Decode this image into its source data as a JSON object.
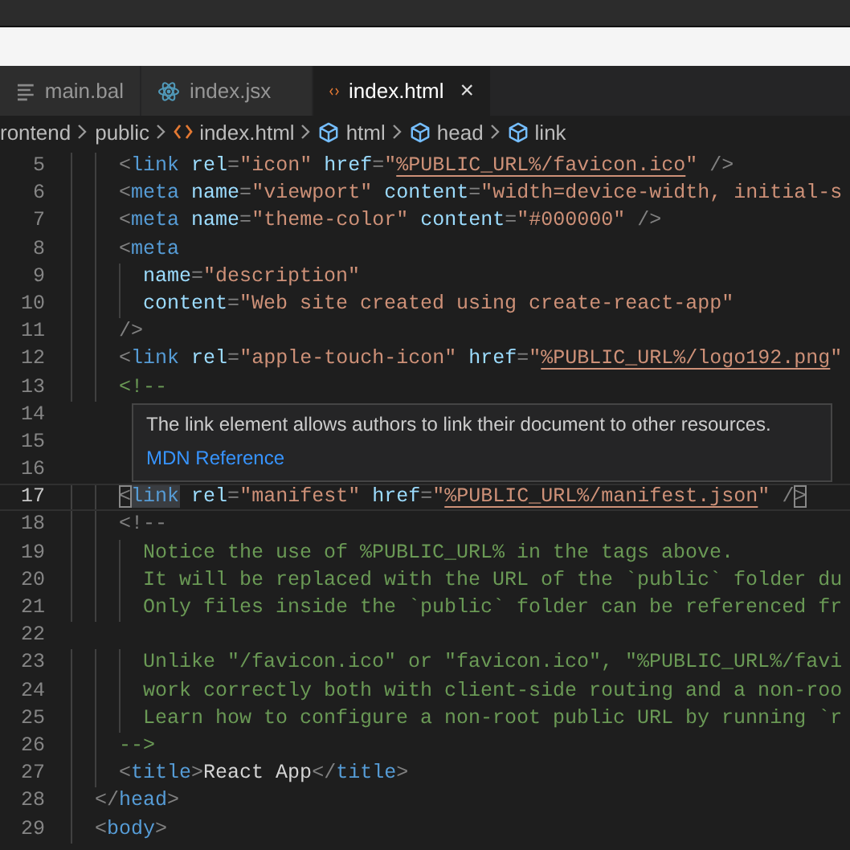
{
  "tabs": [
    {
      "label": "main.bal",
      "kind": "bal",
      "selected": false
    },
    {
      "label": "index.jsx",
      "kind": "react",
      "selected": false
    },
    {
      "label": "index.html",
      "kind": "html",
      "selected": true,
      "close": "×"
    }
  ],
  "breadcrumb": [
    {
      "label": "rontend",
      "kind": "folder"
    },
    {
      "label": "public",
      "kind": "folder"
    },
    {
      "label": "index.html",
      "kind": "file"
    },
    {
      "label": "html",
      "kind": "element"
    },
    {
      "label": "head",
      "kind": "element"
    },
    {
      "label": "link",
      "kind": "element"
    }
  ],
  "lines": [
    {
      "n": "5",
      "current": false,
      "tokens": [
        {
          "kind": "p",
          "text": "    <"
        },
        {
          "kind": "tag",
          "text": "link"
        },
        {
          "kind": "attr",
          "text": " rel"
        },
        {
          "kind": "p",
          "text": "="
        },
        {
          "kind": "str",
          "text": "\"icon\""
        },
        {
          "kind": "attr",
          "text": " href"
        },
        {
          "kind": "p",
          "text": "="
        },
        {
          "kind": "str",
          "text": "\""
        },
        {
          "kind": "url",
          "text": "%PUBLIC_URL%/favicon.ico"
        },
        {
          "kind": "str",
          "text": "\""
        },
        {
          "kind": "p",
          "text": " />"
        }
      ]
    },
    {
      "n": "6",
      "current": false,
      "tokens": [
        {
          "kind": "p",
          "text": "    <"
        },
        {
          "kind": "tag",
          "text": "meta"
        },
        {
          "kind": "attr",
          "text": " name"
        },
        {
          "kind": "p",
          "text": "="
        },
        {
          "kind": "str",
          "text": "\"viewport\""
        },
        {
          "kind": "attr",
          "text": " content"
        },
        {
          "kind": "p",
          "text": "="
        },
        {
          "kind": "str",
          "text": "\"width=device-width, initial-s"
        }
      ]
    },
    {
      "n": "7",
      "current": false,
      "tokens": [
        {
          "kind": "p",
          "text": "    <"
        },
        {
          "kind": "tag",
          "text": "meta"
        },
        {
          "kind": "attr",
          "text": " name"
        },
        {
          "kind": "p",
          "text": "="
        },
        {
          "kind": "str",
          "text": "\"theme-color\""
        },
        {
          "kind": "attr",
          "text": " content"
        },
        {
          "kind": "p",
          "text": "="
        },
        {
          "kind": "str",
          "text": "\"#000000\""
        },
        {
          "kind": "p",
          "text": " />"
        }
      ]
    },
    {
      "n": "8",
      "current": false,
      "tokens": [
        {
          "kind": "p",
          "text": "    <"
        },
        {
          "kind": "tag",
          "text": "meta"
        }
      ]
    },
    {
      "n": "9",
      "current": false,
      "tokens": [
        {
          "kind": "attr",
          "text": "      name"
        },
        {
          "kind": "p",
          "text": "="
        },
        {
          "kind": "str",
          "text": "\"description\""
        }
      ]
    },
    {
      "n": "10",
      "current": false,
      "tokens": [
        {
          "kind": "attr",
          "text": "      content"
        },
        {
          "kind": "p",
          "text": "="
        },
        {
          "kind": "str",
          "text": "\"Web site created using create-react-app\""
        }
      ]
    },
    {
      "n": "11",
      "current": false,
      "tokens": [
        {
          "kind": "p",
          "text": "    />"
        }
      ]
    },
    {
      "n": "12",
      "current": false,
      "tokens": [
        {
          "kind": "p",
          "text": "    <"
        },
        {
          "kind": "tag",
          "text": "link"
        },
        {
          "kind": "attr",
          "text": " rel"
        },
        {
          "kind": "p",
          "text": "="
        },
        {
          "kind": "str",
          "text": "\"apple-touch-icon\""
        },
        {
          "kind": "attr",
          "text": " href"
        },
        {
          "kind": "p",
          "text": "="
        },
        {
          "kind": "str",
          "text": "\""
        },
        {
          "kind": "url",
          "text": "%PUBLIC_URL%/logo192.png"
        },
        {
          "kind": "str",
          "text": "\""
        }
      ]
    },
    {
      "n": "13",
      "current": false,
      "tokens": [
        {
          "kind": "com",
          "text": "    <!--"
        }
      ]
    },
    {
      "n": "14",
      "current": false
    },
    {
      "n": "15",
      "current": false
    },
    {
      "n": "16",
      "current": false
    },
    {
      "n": "17",
      "current": true,
      "tokens": [
        {
          "kind": "match",
          "text": "    <"
        },
        {
          "kind": "sel",
          "text": "link"
        },
        {
          "kind": "attr",
          "text": " rel"
        },
        {
          "kind": "p",
          "text": "="
        },
        {
          "kind": "str",
          "text": "\"manifest\""
        },
        {
          "kind": "attr",
          "text": " href"
        },
        {
          "kind": "p",
          "text": "="
        },
        {
          "kind": "str",
          "text": "\""
        },
        {
          "kind": "url",
          "text": "%PUBLIC_URL%/manifest.json"
        },
        {
          "kind": "str",
          "text": "\""
        },
        {
          "kind": "p",
          "text": " /"
        },
        {
          "kind": "match",
          "text": ">"
        }
      ]
    },
    {
      "n": "18",
      "current": false,
      "tokens": [
        {
          "kind": "p",
          "text": "    <!--"
        }
      ]
    },
    {
      "n": "19",
      "current": false,
      "tokens": [
        {
          "kind": "com",
          "text": "      Notice the use of %PUBLIC_URL% in the tags above."
        }
      ]
    },
    {
      "n": "20",
      "current": false,
      "tokens": [
        {
          "kind": "com",
          "text": "      It will be replaced with the URL of the `public` folder du"
        }
      ]
    },
    {
      "n": "21",
      "current": false,
      "tokens": [
        {
          "kind": "com",
          "text": "      Only files inside the `public` folder can be referenced fr"
        }
      ]
    },
    {
      "n": "22",
      "current": false
    },
    {
      "n": "23",
      "current": false,
      "tokens": [
        {
          "kind": "com",
          "text": "      Unlike \"/favicon.ico\" or \"favicon.ico\", \"%PUBLIC_URL%/favi"
        }
      ]
    },
    {
      "n": "24",
      "current": false,
      "tokens": [
        {
          "kind": "com",
          "text": "      work correctly both with client-side routing and a non-roo"
        }
      ]
    },
    {
      "n": "25",
      "current": false,
      "tokens": [
        {
          "kind": "com",
          "text": "      Learn how to configure a non-root public URL by running `r"
        }
      ]
    },
    {
      "n": "26",
      "current": false,
      "tokens": [
        {
          "kind": "com",
          "text": "    -->"
        }
      ]
    },
    {
      "n": "27",
      "current": false,
      "tokens": [
        {
          "kind": "p",
          "text": "    <"
        },
        {
          "kind": "tag",
          "text": "title"
        },
        {
          "kind": "p",
          "text": ">"
        },
        {
          "kind": "text",
          "text": "React App"
        },
        {
          "kind": "p",
          "text": "</"
        },
        {
          "kind": "tag",
          "text": "title"
        },
        {
          "kind": "p",
          "text": ">"
        }
      ]
    },
    {
      "n": "28",
      "current": false,
      "tokens": [
        {
          "kind": "p",
          "text": "  </"
        },
        {
          "kind": "tag",
          "text": "head"
        },
        {
          "kind": "p",
          "text": ">"
        }
      ]
    },
    {
      "n": "29",
      "current": false,
      "tokens": [
        {
          "kind": "p",
          "text": "  <"
        },
        {
          "kind": "tag",
          "text": "body"
        },
        {
          "kind": "p",
          "text": ">"
        }
      ]
    }
  ],
  "hover": {
    "text": "The link element allows authors to link their document to other resources.",
    "link": "MDN Reference"
  }
}
